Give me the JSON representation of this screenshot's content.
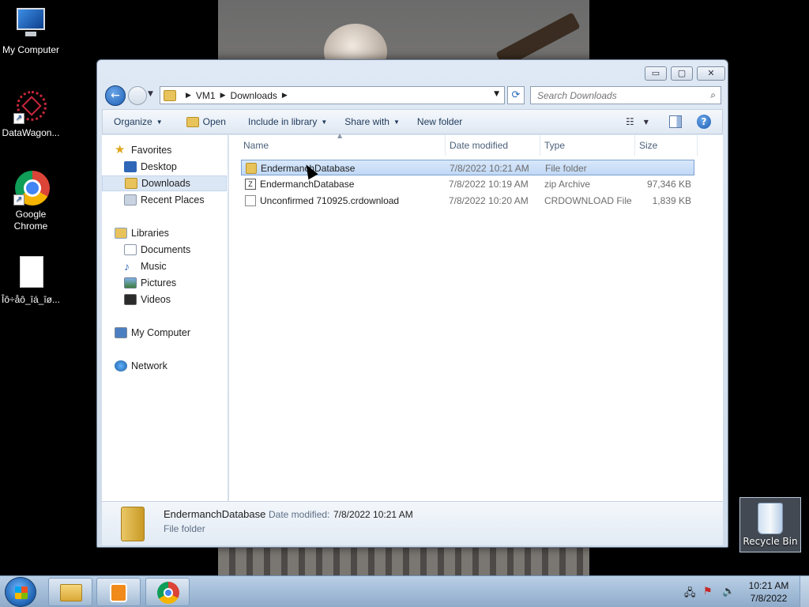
{
  "desktop": {
    "icons": [
      {
        "label": "My Computer",
        "icon": "monitor-icon"
      },
      {
        "label": "DataWagon...",
        "icon": "datawagon-icon"
      },
      {
        "label": "Google Chrome",
        "icon": "chrome-icon"
      },
      {
        "label": "Îô÷åô_îá_îø...",
        "icon": "file-icon"
      }
    ],
    "recycle_bin": "Recycle Bin"
  },
  "window": {
    "caption": {
      "minimize": "▭",
      "maximize": "▢",
      "close": "✕"
    },
    "address": {
      "crumbs": [
        "VM1",
        "Downloads"
      ]
    },
    "search": {
      "placeholder": "Search Downloads"
    },
    "toolbar": {
      "organize": "Organize",
      "open": "Open",
      "include_in_library": "Include in library",
      "share_with": "Share with",
      "new_folder": "New folder"
    },
    "nav": {
      "favorites": "Favorites",
      "desktop": "Desktop",
      "downloads": "Downloads",
      "recent_places": "Recent Places",
      "libraries": "Libraries",
      "documents": "Documents",
      "music": "Music",
      "pictures": "Pictures",
      "videos": "Videos",
      "my_computer": "My Computer",
      "network": "Network"
    },
    "columns": {
      "name": "Name",
      "date": "Date modified",
      "type": "Type",
      "size": "Size"
    },
    "files": [
      {
        "name": "EndermanchDatabase",
        "date": "7/8/2022 10:21 AM",
        "type": "File folder",
        "size": "",
        "icon": "folder-icon"
      },
      {
        "name": "EndermanchDatabase",
        "date": "7/8/2022 10:19 AM",
        "type": "zip Archive",
        "size": "97,346 KB",
        "icon": "zip-icon"
      },
      {
        "name": "Unconfirmed 710925.crdownload",
        "date": "7/8/2022 10:20 AM",
        "type": "CRDOWNLOAD File",
        "size": "1,839 KB",
        "icon": "blank-file-icon"
      }
    ],
    "details": {
      "name": "EndermanchDatabase",
      "modified_label": "Date modified:",
      "modified_value": "7/8/2022 10:21 AM",
      "type": "File folder"
    }
  },
  "taskbar": {
    "time": "10:21 AM",
    "date": "7/8/2022"
  },
  "colors": {
    "selection": "#cce0f7",
    "accent": "#1c5fb5"
  }
}
